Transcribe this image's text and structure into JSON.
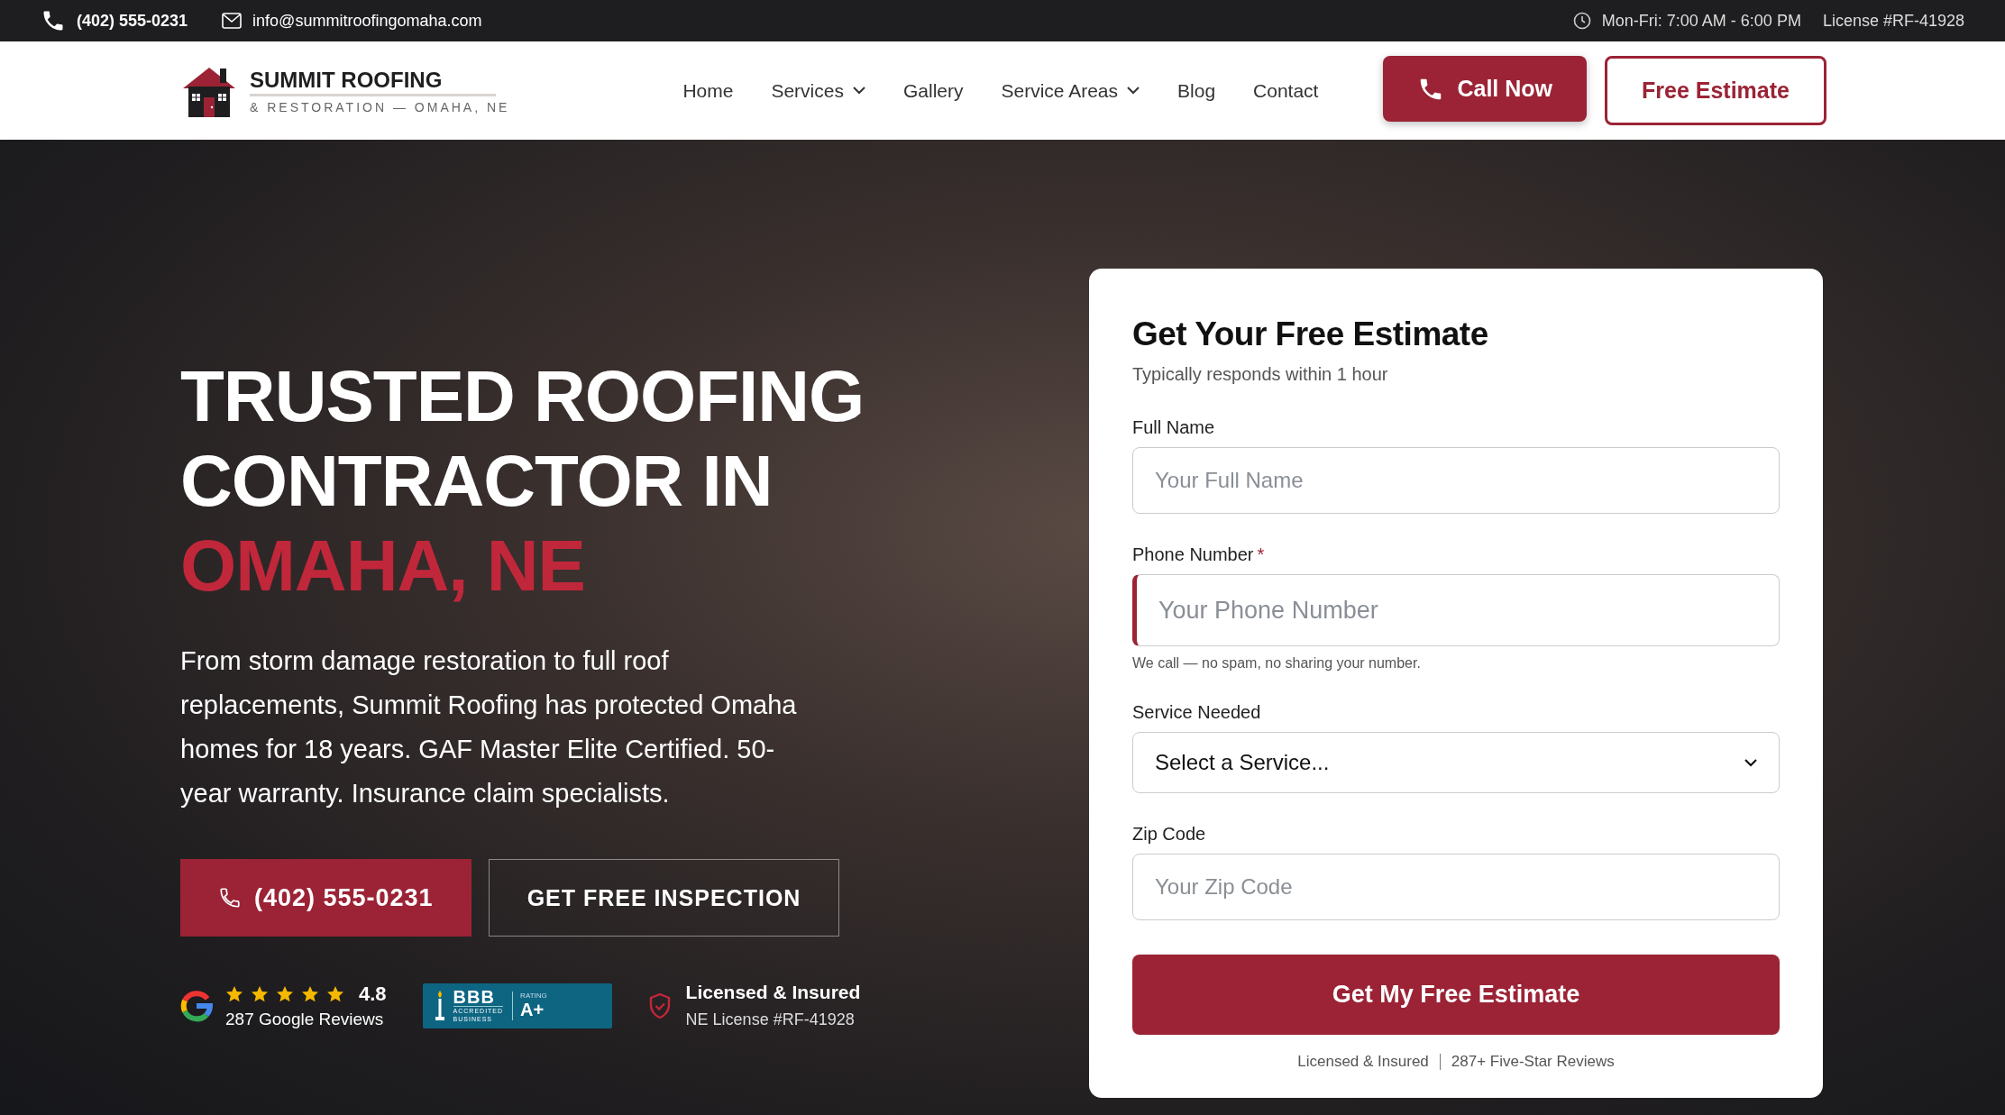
{
  "top_bar": {
    "phone": "(402) 555-0231",
    "email": "info@summitroofingomaha.com",
    "hours": "Mon-Fri: 7:00 AM - 6:00 PM",
    "license": "License #RF-41928"
  },
  "header": {
    "logo": {
      "name": "SUMMIT ROOFING",
      "tagline": "& RESTORATION — OMAHA, NE"
    },
    "nav": [
      {
        "label": "Home",
        "has_dropdown": false
      },
      {
        "label": "Services",
        "has_dropdown": true
      },
      {
        "label": "Gallery",
        "has_dropdown": false
      },
      {
        "label": "Service Areas",
        "has_dropdown": true
      },
      {
        "label": "Blog",
        "has_dropdown": false
      },
      {
        "label": "Contact",
        "has_dropdown": false
      }
    ],
    "call_button": "Call Now",
    "estimate_button": "Free Estimate"
  },
  "hero": {
    "headline": {
      "text": "TRUSTED ROOFING CONTRACTOR IN",
      "highlight": "OMAHA, NE"
    },
    "description": "From storm damage restoration to full roof replacements, Summit Roofing has protected Omaha homes for 18 years. GAF Master Elite Certified. 50-year warranty. Insurance claim specialists.",
    "buttons": [
      {
        "label": "(402) 555-0231",
        "kind": "phone"
      },
      {
        "label": "GET FREE INSPECTION",
        "kind": "outline"
      }
    ],
    "google": {
      "stars": 5,
      "rating": "4.8",
      "reviews": "287 Google Reviews"
    },
    "bbb": {
      "mark": "BBB",
      "line_1": "ACCREDITED",
      "line_2": "BUSINESS",
      "rating_label": "RATING",
      "rating": "A+"
    },
    "license": {
      "title": "Licensed & Insured",
      "subtitle": "NE License #RF-41928"
    }
  },
  "form": {
    "title": "Get Your Free Estimate",
    "subtitle": "Typically responds within 1 hour",
    "fields": [
      {
        "kind": "input",
        "label": "Full Name",
        "required": false,
        "placeholder": "Your Full Name"
      },
      {
        "kind": "input",
        "label": "Phone Number",
        "required": true,
        "required_mark": "*",
        "placeholder": "Your Phone Number",
        "hint": "We call — no spam, no sharing your number."
      },
      {
        "kind": "select",
        "label": "Service Needed",
        "required": false,
        "value": "Select a Service..."
      },
      {
        "kind": "input",
        "label": "Zip Code",
        "required": false,
        "placeholder": "Your Zip Code"
      }
    ],
    "submit": "Get My Free Estimate",
    "footer": [
      "Licensed & Insured",
      "287+ Five-Star Reviews"
    ]
  }
}
